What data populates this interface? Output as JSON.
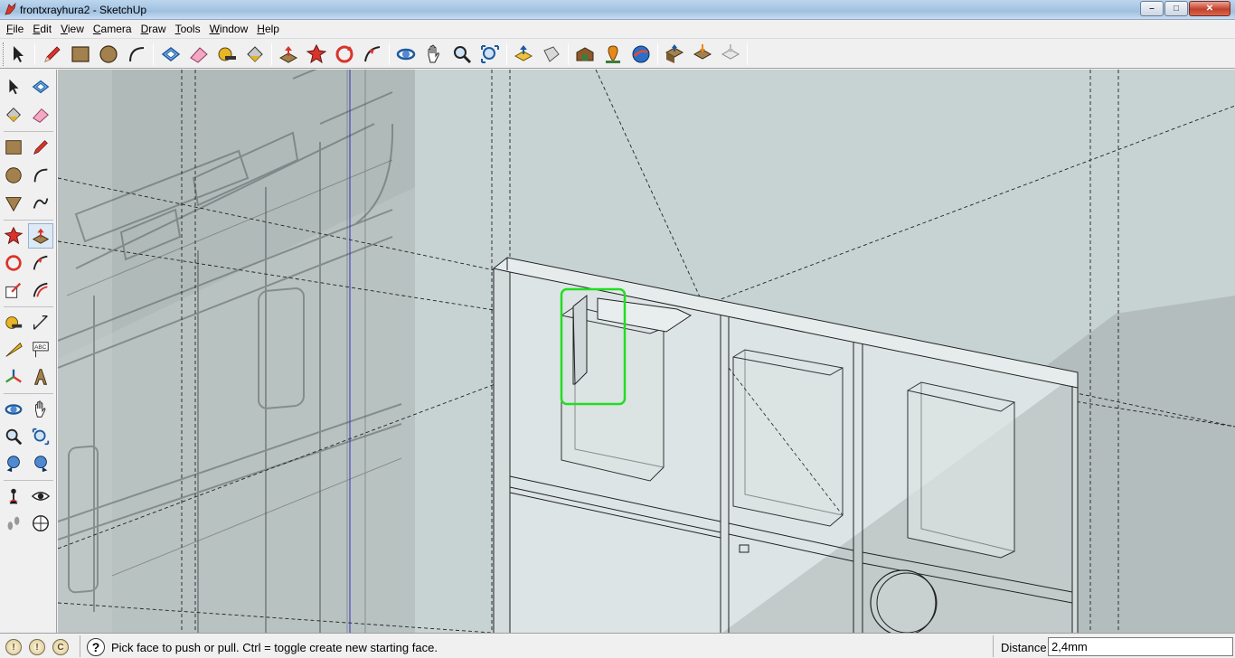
{
  "window": {
    "title": "frontxrayhura2 - SketchUp",
    "minimize_glyph": "–",
    "maximize_glyph": "□",
    "close_glyph": "✕"
  },
  "menu": [
    {
      "label": "File",
      "mnemonic": "F",
      "rest": "ile"
    },
    {
      "label": "Edit",
      "mnemonic": "E",
      "rest": "dit"
    },
    {
      "label": "View",
      "mnemonic": "V",
      "rest": "iew"
    },
    {
      "label": "Camera",
      "mnemonic": "C",
      "rest": "amera"
    },
    {
      "label": "Draw",
      "mnemonic": "D",
      "rest": "raw"
    },
    {
      "label": "Tools",
      "mnemonic": "T",
      "rest": "ools"
    },
    {
      "label": "Window",
      "mnemonic": "W",
      "rest": "indow"
    },
    {
      "label": "Help",
      "mnemonic": "H",
      "rest": "elp"
    }
  ],
  "toolbar_icons": [
    "select-icon",
    "pencil-icon",
    "rectangle-icon",
    "circle-icon",
    "arc-icon",
    "make-component-icon",
    "eraser-icon",
    "tape-measure-icon",
    "paint-bucket-icon",
    "push-pull-icon",
    "move-icon",
    "rotate-icon",
    "follow-me-icon",
    "orbit-icon",
    "pan-icon",
    "zoom-icon",
    "zoom-extents-icon",
    "import-icon",
    "export-icon",
    "3d-warehouse-icon",
    "add-location-icon",
    "google-earth-icon",
    "get-models-icon",
    "share-model-icon",
    "share-component-icon"
  ],
  "left_tools": [
    "select-icon",
    "make-component-icon",
    "paint-bucket-icon",
    "eraser-icon",
    "rectangle-icon",
    "line-icon",
    "circle-icon",
    "arc-icon",
    "polygon-icon",
    "freehand-icon",
    "move-icon",
    "push-pull-icon",
    "rotate-icon",
    "follow-me-icon",
    "scale-icon",
    "offset-icon",
    "tape-measure-icon",
    "dimension-icon",
    "protractor-icon",
    "text-icon",
    "axes-icon",
    "3d-text-icon",
    "orbit-icon",
    "pan-icon",
    "zoom-icon",
    "zoom-window-icon",
    "previous-view-icon",
    "next-view-icon",
    "position-camera-icon",
    "look-around-icon",
    "walk-icon",
    "section-plane-icon"
  ],
  "status": {
    "message": "Pick face to push or pull.  Ctrl = toggle create new starting face.",
    "vcb_label": "Distance",
    "vcb_value": "2,4mm",
    "help_glyph": "?",
    "geo_glyphs": [
      "!",
      "!",
      "C"
    ]
  },
  "colors": {
    "viewport_bg": "#c5d1d1",
    "selection_highlight": "#22dd22",
    "axis_blue": "#3030c0"
  }
}
